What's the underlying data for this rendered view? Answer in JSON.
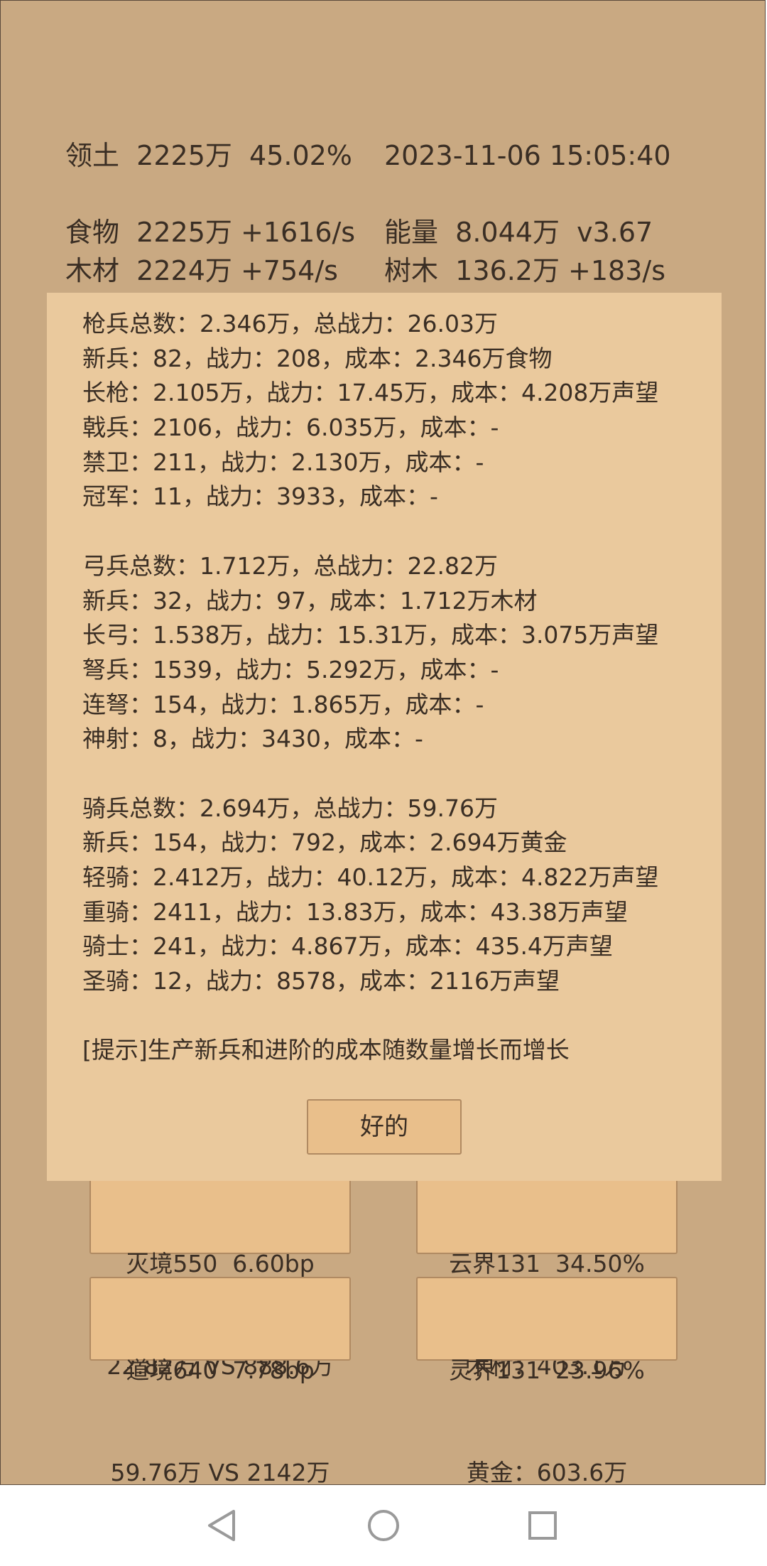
{
  "header": {
    "territory": "领土  2225万  45.02%",
    "datetime": "2023-11-06 15:05:40"
  },
  "resources": {
    "food": "食物  2225万 +1616/s",
    "energy": "能量  8.044万  v3.67",
    "wood": "木材  2224万 +754/s",
    "trees": "树木  136.2万 +183/s"
  },
  "dialog": {
    "lines": [
      "枪兵总数：2.346万，总战力：26.03万",
      "新兵：82，战力：208，成本：2.346万食物",
      "长枪：2.105万，战力：17.45万，成本：4.208万声望",
      "戟兵：2106，战力：6.035万，成本：-",
      "禁卫：211，战力：2.130万，成本：-",
      "冠军：11，战力：3933，成本：-",
      "",
      "弓兵总数：1.712万，总战力：22.82万",
      "新兵：32，战力：97，成本：1.712万木材",
      "长弓：1.538万，战力：15.31万，成本：3.075万声望",
      "弩兵：1539，战力：5.292万，成本：-",
      "连弩：154，战力：1.865万，成本：-",
      "神射：8，战力：3430，成本：-",
      "",
      "骑兵总数：2.694万，总战力：59.76万",
      "新兵：154，战力：792，成本：2.694万黄金",
      "轻骑：2.412万，战力：40.12万，成本：4.822万声望",
      "重骑：2411，战力：13.83万，成本：43.38万声望",
      "骑士：241，战力：4.867万，成本：435.4万声望",
      "圣骑：12，战力：8578，成本：2116万声望",
      "",
      "[提示]生产新兵和进阶的成本随数量增长而增长"
    ],
    "ok_label": "好的"
  },
  "buttons": {
    "b1_line1": "灭境550  6.60bp",
    "b1_line2": "22.82万 VS 888.6万",
    "b2_line1": "云界131  34.50%",
    "b2_line2": "木材：403.1万",
    "b3_line1": "道境640  7.78bp",
    "b3_line2": "59.76万 VS 2142万",
    "b4_line1": "灵界131  23.96%",
    "b4_line2": "黄金：603.6万"
  },
  "colors": {
    "background": "#c9a982",
    "dialog": "#eac99d",
    "button": "#e9bf8b",
    "text": "#3a2e24"
  },
  "icons": {
    "back": "back-icon",
    "home": "home-icon",
    "recents": "recents-icon"
  }
}
